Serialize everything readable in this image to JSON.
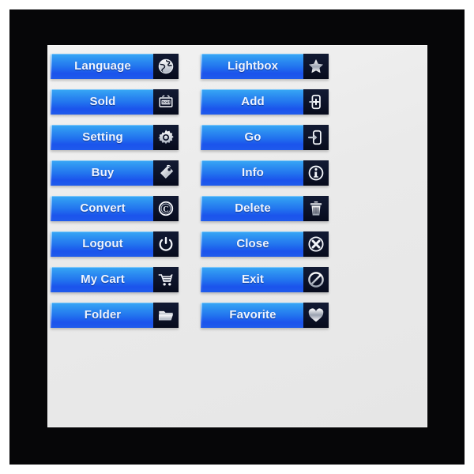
{
  "theme": {
    "frame_color": "#060608",
    "panel_color": "#eaeaea",
    "button_gradient_top": "#39a9f6",
    "button_gradient_bottom": "#1b53ec",
    "icon_box_color": "#0c1228",
    "label_color": "#eef4ff"
  },
  "button_set": {
    "columns": [
      {
        "name": "left-column",
        "buttons": [
          {
            "label": "Language",
            "icon": "globe-icon"
          },
          {
            "label": "Sold",
            "icon": "sold-sign-icon"
          },
          {
            "label": "Setting",
            "icon": "gear-icon"
          },
          {
            "label": "Buy",
            "icon": "price-tag-icon"
          },
          {
            "label": "Convert",
            "icon": "copyright-circle-icon"
          },
          {
            "label": "Logout",
            "icon": "power-icon"
          },
          {
            "label": "My Cart",
            "icon": "shopping-cart-icon"
          },
          {
            "label": "Folder",
            "icon": "folder-icon"
          }
        ]
      },
      {
        "name": "right-column",
        "buttons": [
          {
            "label": "Lightbox",
            "icon": "star-icon"
          },
          {
            "label": "Add",
            "icon": "add-to-box-icon"
          },
          {
            "label": "Go",
            "icon": "arrow-into-box-icon"
          },
          {
            "label": "Info",
            "icon": "info-circle-icon"
          },
          {
            "label": "Delete",
            "icon": "trash-can-icon"
          },
          {
            "label": "Close",
            "icon": "close-circle-icon"
          },
          {
            "label": "Exit",
            "icon": "prohibited-icon"
          },
          {
            "label": "Favorite",
            "icon": "heart-icon"
          }
        ]
      }
    ]
  }
}
